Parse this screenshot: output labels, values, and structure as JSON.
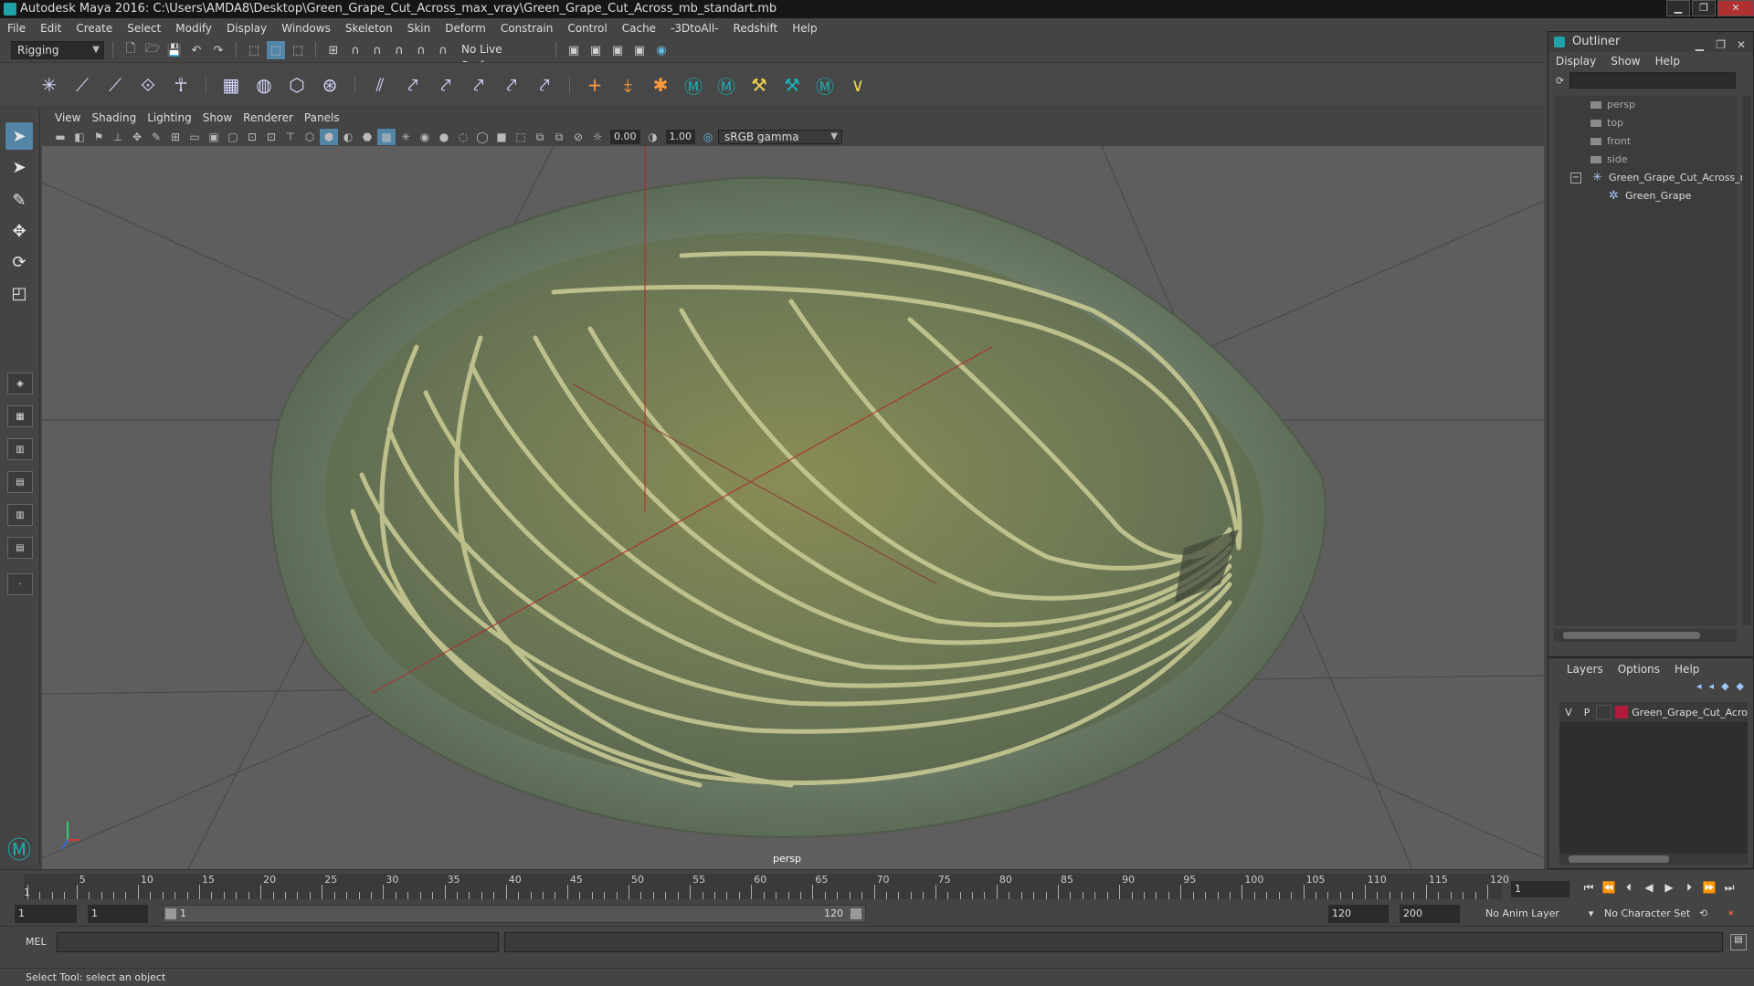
{
  "window": {
    "title": "Autodesk Maya 2016: C:\\Users\\AMDA8\\Desktop\\Green_Grape_Cut_Across_max_vray\\Green_Grape_Cut_Across_mb_standart.mb",
    "minimize": "▁",
    "maximize": "❐",
    "close": "✕"
  },
  "menus": [
    "File",
    "Edit",
    "Create",
    "Select",
    "Modify",
    "Display",
    "Windows",
    "Skeleton",
    "Skin",
    "Deform",
    "Constrain",
    "Control",
    "Cache",
    "-3DtoAll-",
    "Redshift",
    "Help"
  ],
  "status": {
    "mode": "Rigging",
    "live_surface": "No Live Surface"
  },
  "viewport": {
    "menus": [
      "View",
      "Shading",
      "Lighting",
      "Show",
      "Renderer",
      "Panels"
    ],
    "exposure": "0.00",
    "gamma": "1.00",
    "color_space": "sRGB gamma",
    "camera": "persp"
  },
  "outliner": {
    "title": "Outliner",
    "menus": [
      "Display",
      "Show",
      "Help"
    ],
    "cameras": [
      "persp",
      "top",
      "front",
      "side"
    ],
    "group": "Green_Grape_Cut_Across_r",
    "child": "Green_Grape"
  },
  "layers": {
    "menus": [
      "Layers",
      "Options",
      "Help"
    ],
    "row": {
      "v": "V",
      "p": "P",
      "name": "Green_Grape_Cut_Acro",
      "color": "#b21a3a"
    }
  },
  "timeslider": {
    "ticks": [
      "1",
      "5",
      "10",
      "15",
      "20",
      "25",
      "30",
      "35",
      "40",
      "45",
      "50",
      "55",
      "60",
      "65",
      "70",
      "75",
      "80",
      "85",
      "90",
      "95",
      "100",
      "105",
      "110",
      "115",
      "120"
    ],
    "current_frame": "1"
  },
  "range": {
    "start": "1",
    "playback_start": "1",
    "range_start": "1",
    "range_end": "120",
    "playback_end": "120",
    "end": "200",
    "anim_layer": "No Anim Layer",
    "character_set": "No Character Set"
  },
  "command": {
    "label": "MEL"
  },
  "help_line": "Select Tool: select an object"
}
